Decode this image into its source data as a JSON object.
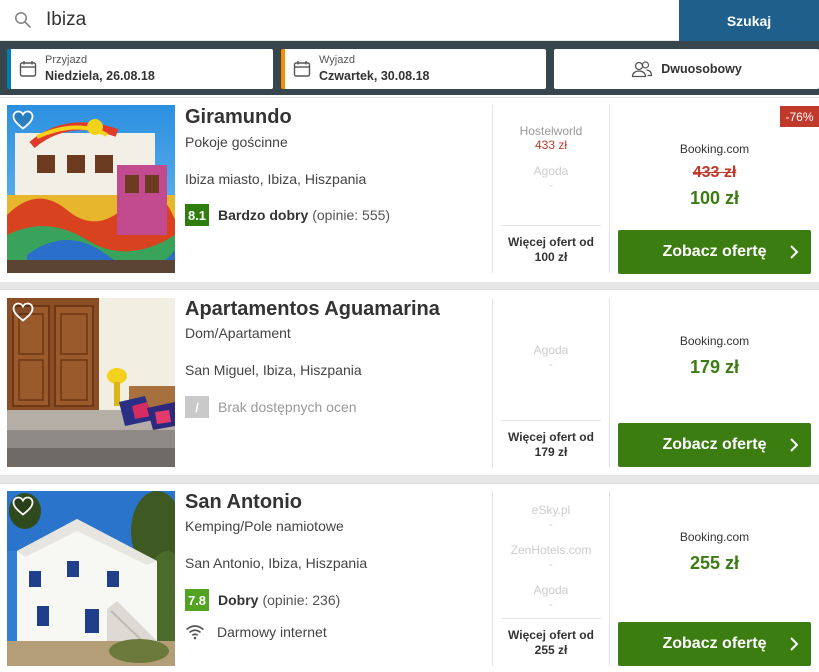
{
  "search": {
    "value": "Ibiza",
    "button_label": "Szukaj"
  },
  "dates": {
    "checkin_label": "Przyjazd",
    "checkin_value": "Niedziela, 26.08.18",
    "checkout_label": "Wyjazd",
    "checkout_value": "Czwartek, 30.08.18",
    "guests_value": "Dwuosobowy"
  },
  "colors": {
    "search_button": "#1f5f8b",
    "checkin_accent": "#007faf",
    "checkout_accent": "#f48f00",
    "cta_green": "#3c7d12",
    "price_red": "#c0392b"
  },
  "results": [
    {
      "name": "Giramundo",
      "type": "Pokoje gościnne",
      "location": "Ibiza miasto, Ibiza, Hiszpania",
      "score": "8.1",
      "rating_text": "Bardzo dobry",
      "rating_count": "(opinie: 555)",
      "alternatives": [
        {
          "name": "Hostelworld",
          "price": "433 zł"
        },
        {
          "name": "Agoda",
          "price": "-"
        }
      ],
      "more_offers": "Więcej ofert od",
      "more_offers_price": "100 zł",
      "discount": "-76%",
      "provider": "Booking.com",
      "old_price": "433 zł",
      "price": "100 zł",
      "cta": "Zobacz ofertę"
    },
    {
      "name": "Apartamentos Aguamarina",
      "type": "Dom/Apartament",
      "location": "San Miguel, Ibiza, Hiszpania",
      "score": "/",
      "rating_text": "Brak dostępnych ocen",
      "alternatives": [
        {
          "name": "Agoda",
          "price": "-"
        }
      ],
      "more_offers": "Więcej ofert od",
      "more_offers_price": "179 zł",
      "provider": "Booking.com",
      "price": "179 zł",
      "cta": "Zobacz ofertę"
    },
    {
      "name": "San Antonio",
      "type": "Kemping/Pole namiotowe",
      "location": "San Antonio, Ibiza, Hiszpania",
      "score": "7.8",
      "rating_text": "Dobry",
      "rating_count": "(opinie: 236)",
      "amenity": "Darmowy internet",
      "alternatives": [
        {
          "name": "eSky.pl",
          "price": "-"
        },
        {
          "name": "ZenHotels.com",
          "price": "-"
        },
        {
          "name": "Agoda",
          "price": "-"
        }
      ],
      "more_offers": "Więcej ofert od",
      "more_offers_price": "255 zł",
      "provider": "Booking.com",
      "price": "255 zł",
      "cta": "Zobacz ofertę"
    }
  ]
}
